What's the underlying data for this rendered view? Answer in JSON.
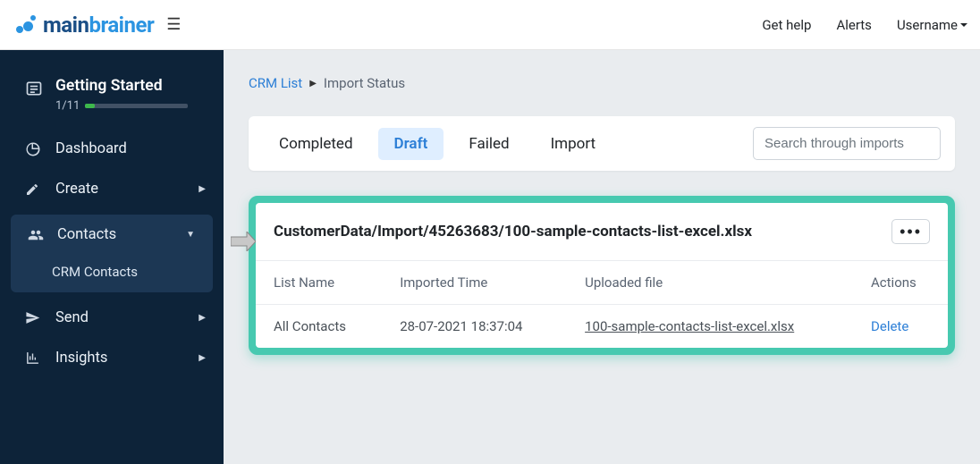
{
  "header": {
    "logo_main": "main",
    "logo_brainer": "brainer",
    "get_help": "Get help",
    "alerts": "Alerts",
    "username": "Username"
  },
  "sidebar": {
    "getting_started": {
      "label": "Getting Started",
      "progress": "1/11"
    },
    "dashboard": "Dashboard",
    "create": "Create",
    "contacts": "Contacts",
    "crm_contacts": "CRM Contacts",
    "send": "Send",
    "insights": "Insights"
  },
  "breadcrumb": {
    "crm_list": "CRM List",
    "import_status": "Import Status"
  },
  "tabs": {
    "completed": "Completed",
    "draft": "Draft",
    "failed": "Failed",
    "import": "Import"
  },
  "search": {
    "placeholder": "Search through imports"
  },
  "panel": {
    "title": "CustomerData/Import/45263683/100-sample-contacts-list-excel.xlsx",
    "columns": {
      "list_name": "List Name",
      "imported_time": "Imported Time",
      "uploaded_file": "Uploaded file",
      "actions": "Actions"
    },
    "rows": [
      {
        "list_name": "All Contacts",
        "imported_time": "28-07-2021 18:37:04",
        "uploaded_file": "100-sample-contacts-list-excel.xlsx",
        "action": "Delete"
      }
    ]
  }
}
